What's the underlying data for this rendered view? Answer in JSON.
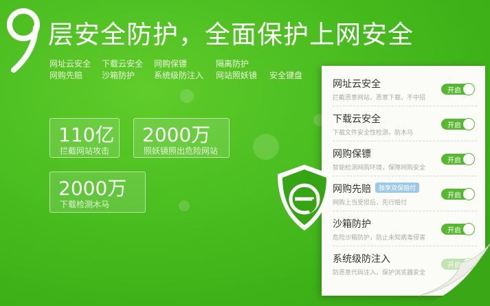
{
  "headline": {
    "digit": "9",
    "text": "层安全防护，全面保护上网安全"
  },
  "features": [
    "网址云安全",
    "下载云安全",
    "网购保镖",
    "隔离防护",
    "网购先赔",
    "沙箱防护",
    "系统级防注入",
    "网站照妖镜",
    "安全键盘"
  ],
  "stats": [
    {
      "number": "110亿",
      "label": "拦截网站攻击"
    },
    {
      "number": "2000万",
      "label": "照妖镜照出危险网站"
    },
    {
      "number": "2000万",
      "label": "下载检测木马"
    }
  ],
  "panel": {
    "toggle_label": "开启",
    "badge": "独享双保赔付",
    "items": [
      {
        "title": "网址云安全",
        "desc": "拦截恶意网站，恶意下载，不中招"
      },
      {
        "title": "下载云安全",
        "desc": "下载文件安全性检测，防木马"
      },
      {
        "title": "网购保镖",
        "desc": "智能检测网购环境，保障网购安全"
      },
      {
        "title": "网购先赔",
        "desc": "网购上当受损后，先行赔付"
      },
      {
        "title": "沙箱防护",
        "desc": "危险沙箱防护，防止未知病毒侵害"
      },
      {
        "title": "系统级防注入",
        "desc": "防恶意代码注入，保护浏览器安全"
      }
    ]
  },
  "colors": {
    "bg": "#43b81c",
    "toggle": "#56b82e",
    "panel": "#fbfbf8"
  }
}
